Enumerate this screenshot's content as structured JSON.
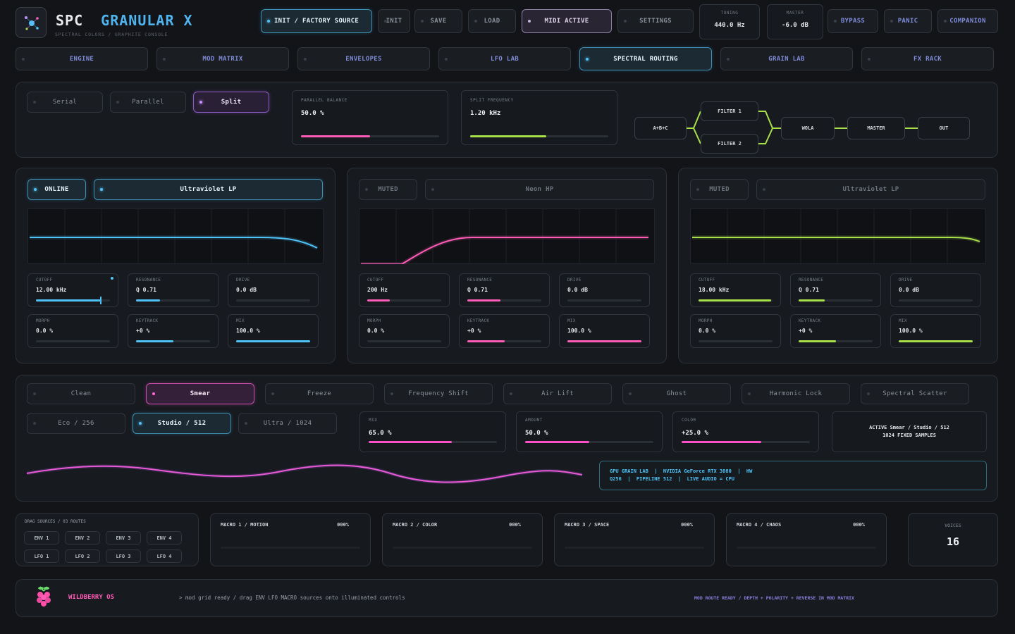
{
  "header": {
    "brand_a": "SPC",
    "brand_b": "GRANULAR X",
    "subtitle": "SPECTRAL COLORS / GRAPHITE CONSOLE",
    "preset": "INIT / FACTORY SOURCE",
    "buttons": {
      "init": "INIT",
      "save": "SAVE",
      "load": "LOAD",
      "midi": "MIDI ACTIVE",
      "settings": "SETTINGS",
      "bypass": "BYPASS",
      "panic": "PANIC",
      "companion": "COMPANION"
    },
    "tuning": {
      "label": "TUNING",
      "value": "440.0 Hz"
    },
    "master": {
      "label": "MASTER",
      "value": "-6.0 dB"
    }
  },
  "tabs": [
    "ENGINE",
    "MOD MATRIX",
    "ENVELOPES",
    "LFO LAB",
    "SPECTRAL ROUTING",
    "GRAIN LAB",
    "FX RACK"
  ],
  "active_tab": "SPECTRAL ROUTING",
  "routing": {
    "modes": [
      "Serial",
      "Parallel",
      "Split"
    ],
    "active_mode": "Split",
    "parallel_balance": {
      "label": "PARALLEL BALANCE",
      "value": "50.0 %",
      "level": 0.5
    },
    "split_frequency": {
      "label": "SPLIT FREQUENCY",
      "value": "1.20 kHz",
      "level": 0.55
    },
    "graph": {
      "src": "A+B+C",
      "f1": "FILTER 1",
      "f2": "FILTER 2",
      "wola": "WOLA",
      "master": "MASTER",
      "out": "OUT"
    }
  },
  "filters": [
    {
      "state": "ONLINE",
      "type": "Ultraviolet LP",
      "color": "#4fc3f7",
      "knobs": [
        {
          "label": "CUTOFF",
          "value": "12.00 kHz",
          "level": 0.88
        },
        {
          "label": "RESONANCE",
          "value": "Q 0.71",
          "level": 0.32
        },
        {
          "label": "DRIVE",
          "value": "0.0 dB",
          "level": 0
        },
        {
          "label": "MORPH",
          "value": "0.0 %",
          "level": 0
        },
        {
          "label": "KEYTRACK",
          "value": "+0 %",
          "level": 0.5
        },
        {
          "label": "MIX",
          "value": "100.0 %",
          "level": 1
        }
      ]
    },
    {
      "state": "MUTED",
      "type": "Neon HP",
      "color": "#ff5cb8",
      "knobs": [
        {
          "label": "CUTOFF",
          "value": "200 Hz",
          "level": 0.3
        },
        {
          "label": "RESONANCE",
          "value": "Q 0.71",
          "level": 0.45
        },
        {
          "label": "DRIVE",
          "value": "0.0 dB",
          "level": 0
        },
        {
          "label": "MORPH",
          "value": "0.0 %",
          "level": 0
        },
        {
          "label": "KEYTRACK",
          "value": "+0 %",
          "level": 0.5
        },
        {
          "label": "MIX",
          "value": "100.0 %",
          "level": 1
        }
      ]
    },
    {
      "state": "MUTED",
      "type": "Ultraviolet LP",
      "color": "#a8e04a",
      "knobs": [
        {
          "label": "CUTOFF",
          "value": "18.00 kHz",
          "level": 0.98
        },
        {
          "label": "RESONANCE",
          "value": "Q 0.71",
          "level": 0.35
        },
        {
          "label": "DRIVE",
          "value": "0.0 dB",
          "level": 0
        },
        {
          "label": "MORPH",
          "value": "0.0 %",
          "level": 0
        },
        {
          "label": "KEYTRACK",
          "value": "+0 %",
          "level": 0.5
        },
        {
          "label": "MIX",
          "value": "100.0 %",
          "level": 1
        }
      ]
    }
  ],
  "spectral": {
    "modes": [
      "Clean",
      "Smear",
      "Freeze",
      "Frequency Shift",
      "Air Lift",
      "Ghost",
      "Harmonic Lock",
      "Spectral Scatter"
    ],
    "active_mode": "Smear",
    "quality": [
      "Eco / 256",
      "Studio / 512",
      "Ultra / 1024"
    ],
    "active_quality": "Studio / 512",
    "params": [
      {
        "label": "MIX",
        "value": "65.0 %",
        "level": 0.65
      },
      {
        "label": "AMOUNT",
        "value": "50.0 %",
        "level": 0.5
      },
      {
        "label": "COLOR",
        "value": "+25.0 %",
        "level": 0.62
      }
    ],
    "status_line1": "ACTIVE Smear / Studio / 512",
    "status_line2": "1024 FIXED SAMPLES",
    "gpu_line1": "GPU GRAIN LAB  |  NVIDIA GeForce RTX 3080  |  HW",
    "gpu_line2": "Q256  |  PIPELINE 512  |  LIVE AUDIO = CPU"
  },
  "mod": {
    "title": "DRAG SOURCES / 03 ROUTES",
    "sources": [
      "ENV 1",
      "ENV 2",
      "ENV 3",
      "ENV 4",
      "LFO 1",
      "LFO 2",
      "LFO 3",
      "LFO 4"
    ]
  },
  "macros": [
    {
      "label": "MACRO 1 / MOTION",
      "value": "000%"
    },
    {
      "label": "MACRO 2 / COLOR",
      "value": "000%"
    },
    {
      "label": "MACRO 3 / SPACE",
      "value": "000%"
    },
    {
      "label": "MACRO 4 / CHAOS",
      "value": "000%"
    }
  ],
  "voices": {
    "label": "VOICES",
    "value": "16"
  },
  "footer": {
    "os": "WILDBERRY OS",
    "message": "> mod grid ready / drag ENV LFO MACRO sources onto illuminated controls",
    "status": "MOD ROUTE READY / DEPTH + POLARITY + REVERSE IN MOD MATRIX"
  }
}
